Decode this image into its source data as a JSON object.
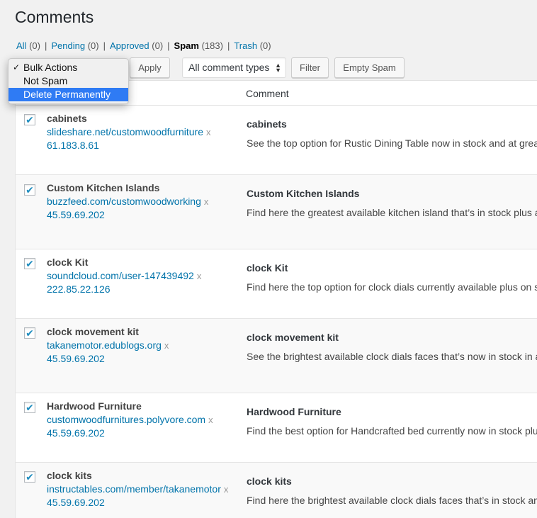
{
  "page_title": "Comments",
  "filters": [
    {
      "label": "All",
      "count": "(0)"
    },
    {
      "label": "Pending",
      "count": "(0)"
    },
    {
      "label": "Approved",
      "count": "(0)"
    },
    {
      "label": "Spam",
      "count": "(183)"
    },
    {
      "label": "Trash",
      "count": "(0)"
    }
  ],
  "separator": "|",
  "toolbar": {
    "apply_label": "Apply",
    "comment_type_label": "All comment types",
    "filter_label": "Filter",
    "empty_spam_label": "Empty Spam"
  },
  "bulk_actions": {
    "check": "✓",
    "options": [
      "Bulk Actions",
      "Not Spam",
      "Delete Permanently"
    ],
    "current": "Bulk Actions",
    "highlighted": "Delete Permanently"
  },
  "table": {
    "column_comment": "Comment",
    "remove_mark": "x",
    "check_mark": "✔",
    "rows": [
      {
        "author": "cabinets",
        "url": "slideshare.net/customwoodfurniture",
        "ip": "61.183.8.61",
        "title": "cabinets",
        "text": "See the top option for Rustic Dining Table now in stock and at great"
      },
      {
        "author": "Custom Kitchen Islands",
        "url": "buzzfeed.com/customwoodworking",
        "ip": "45.59.69.202",
        "title": "Custom Kitchen Islands",
        "text": "Find here the greatest available kitchen island that’s in stock plus at"
      },
      {
        "author": "clock Kit",
        "url": "soundcloud.com/user-147439492",
        "ip": "222.85.22.126",
        "title": "clock Kit",
        "text": "Find here the top option for clock dials currently available plus on s"
      },
      {
        "author": "clock movement kit",
        "url": "takanemotor.edublogs.org",
        "ip": "45.59.69.202",
        "title": "clock movement kit",
        "text": "See the brightest available clock dials faces that’s now in stock in a"
      },
      {
        "author": "Hardwood Furniture",
        "url": "customwoodfurnitures.polyvore.com",
        "ip": "45.59.69.202",
        "title": "Hardwood Furniture",
        "text": "Find the best option for Handcrafted bed currently now in stock plu"
      },
      {
        "author": "clock kits",
        "url": "instructables.com/member/takanemotor",
        "ip": "45.59.69.202",
        "title": "clock kits",
        "text": "Find here the brightest available clock dials faces that’s in stock an"
      }
    ]
  }
}
